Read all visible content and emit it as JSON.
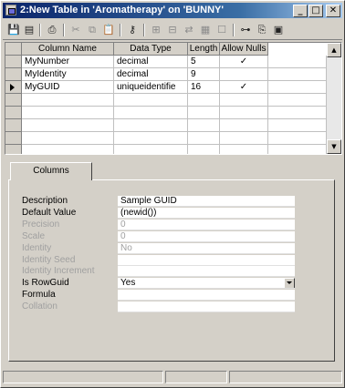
{
  "window": {
    "title": "2:New Table in 'Aromatherapy' on 'BUNNY'",
    "controls": {
      "minimize": "_",
      "maximize": "□",
      "close": "✕"
    }
  },
  "toolbar": {
    "icons": [
      "save-icon",
      "table-properties-icon",
      "print-icon",
      "cut-icon",
      "copy-icon",
      "paste-icon",
      "primary-key-icon",
      "insert-column-icon",
      "delete-column-icon",
      "relationships-icon",
      "manage-indexes-icon",
      "constraints-icon",
      "triggers-icon",
      "generate-script-icon"
    ]
  },
  "grid": {
    "columns": [
      "Column Name",
      "Data Type",
      "Length",
      "Allow Nulls"
    ],
    "rows": [
      {
        "name": "MyNumber",
        "type": "decimal",
        "length": "5",
        "nulls": "✓"
      },
      {
        "name": "MyIdentity",
        "type": "decimal",
        "length": "9",
        "nulls": ""
      },
      {
        "name": "MyGUID",
        "type": "uniqueidentifie",
        "length": "16",
        "nulls": "✓"
      },
      {
        "name": "",
        "type": "",
        "length": "",
        "nulls": ""
      },
      {
        "name": "",
        "type": "",
        "length": "",
        "nulls": ""
      },
      {
        "name": "",
        "type": "",
        "length": "",
        "nulls": ""
      },
      {
        "name": "",
        "type": "",
        "length": "",
        "nulls": ""
      },
      {
        "name": "",
        "type": "",
        "length": "",
        "nulls": ""
      }
    ],
    "current_row": 2
  },
  "tab": {
    "label": "Columns"
  },
  "properties": [
    {
      "label": "Description",
      "value": "Sample GUID",
      "enabled": true
    },
    {
      "label": "Default Value",
      "value": "(newid())",
      "enabled": true
    },
    {
      "label": "Precision",
      "value": "0",
      "enabled": false
    },
    {
      "label": "Scale",
      "value": "0",
      "enabled": false
    },
    {
      "label": "Identity",
      "value": "No",
      "enabled": false
    },
    {
      "label": "Identity Seed",
      "value": "",
      "enabled": false
    },
    {
      "label": "Identity Increment",
      "value": "",
      "enabled": false
    },
    {
      "label": "Is RowGuid",
      "value": "Yes",
      "enabled": true,
      "dropdown": true
    },
    {
      "label": "Formula",
      "value": "",
      "enabled": true
    },
    {
      "label": "Collation",
      "value": "",
      "enabled": false
    }
  ]
}
